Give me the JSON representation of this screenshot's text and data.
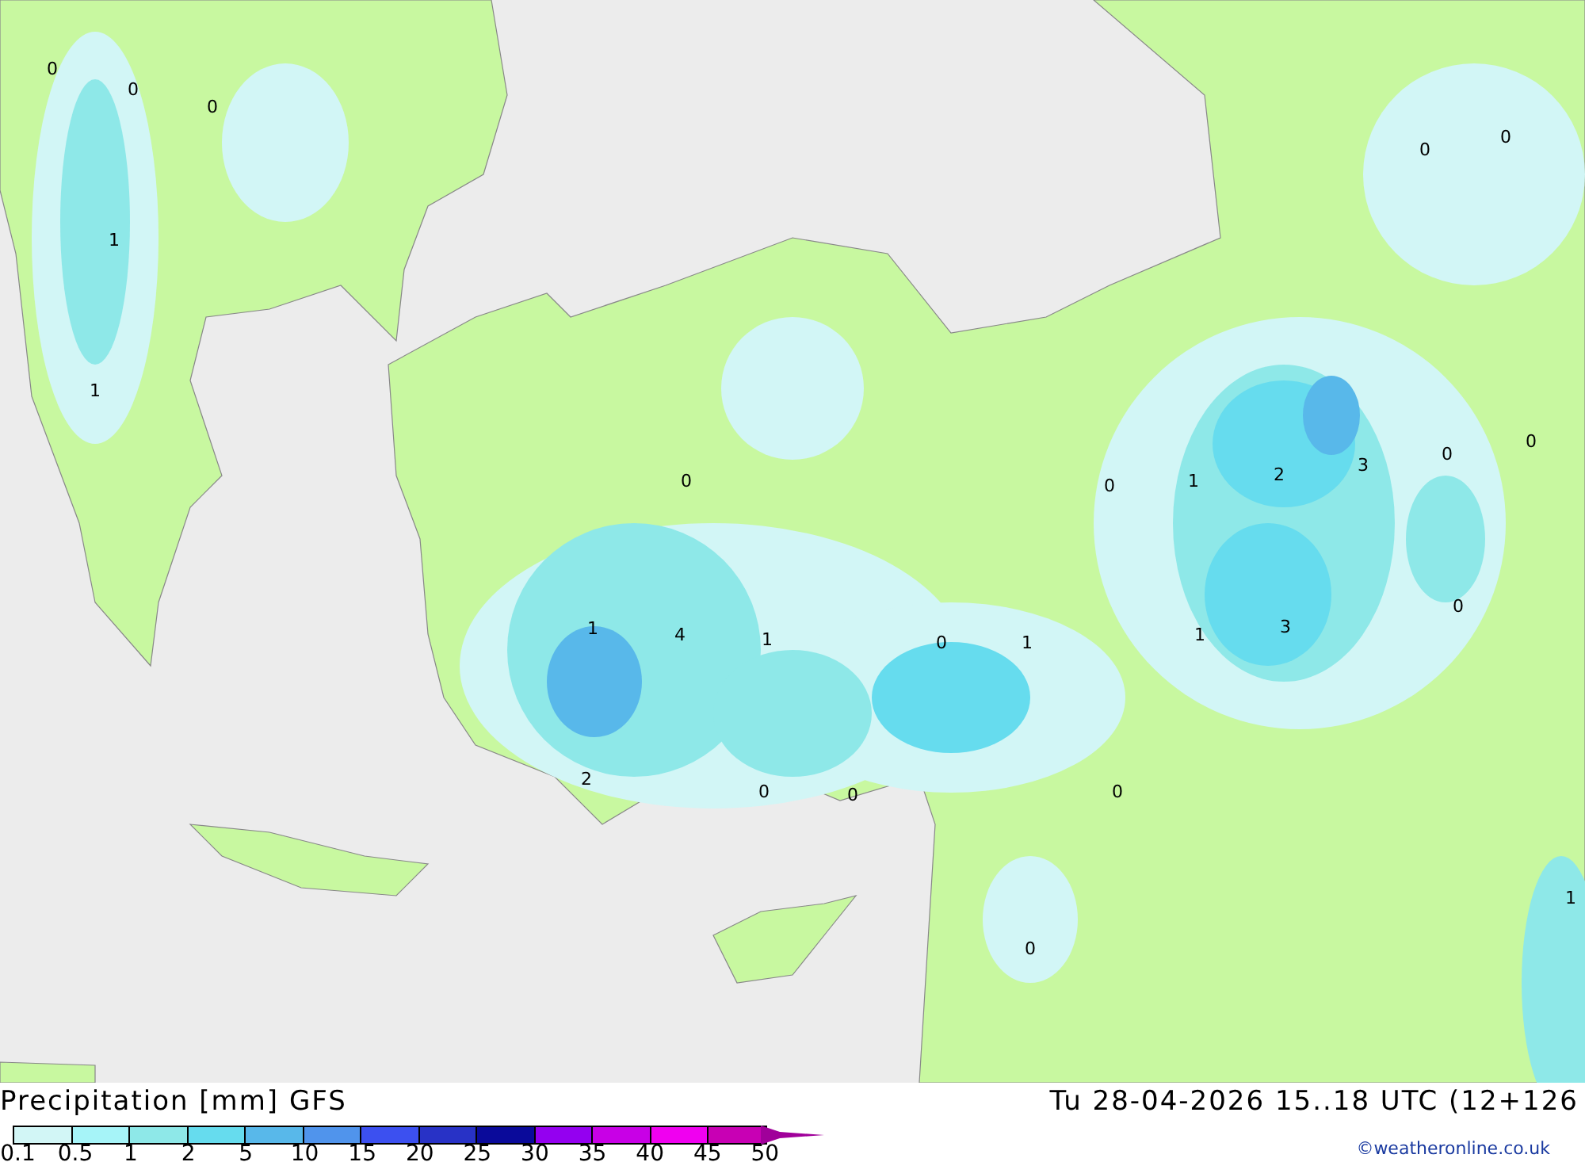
{
  "map": {
    "labels": [
      "0",
      "0",
      "0",
      "1",
      "1",
      "0",
      "0",
      "0",
      "0",
      "1",
      "2",
      "3",
      "0",
      "0",
      "1",
      "4",
      "1",
      "0",
      "1",
      "1",
      "3",
      "0",
      "2",
      "0",
      "0",
      "0",
      "0",
      "1"
    ]
  },
  "legend": {
    "title": "Precipitation [mm] GFS",
    "steps": [
      {
        "label": "0.1",
        "color": "#d2f6f6"
      },
      {
        "label": "0.5",
        "color": "#a6f4f8"
      },
      {
        "label": "1",
        "color": "#8ee8e8"
      },
      {
        "label": "2",
        "color": "#66dcee"
      },
      {
        "label": "5",
        "color": "#58b8ea"
      },
      {
        "label": "10",
        "color": "#5094ec"
      },
      {
        "label": "15",
        "color": "#3c50f0"
      },
      {
        "label": "20",
        "color": "#2832c6"
      },
      {
        "label": "25",
        "color": "#0a0a9a"
      },
      {
        "label": "30",
        "color": "#9400f0"
      },
      {
        "label": "35",
        "color": "#c800e6"
      },
      {
        "label": "40",
        "color": "#f000f0"
      },
      {
        "label": "45",
        "color": "#c800b4"
      }
    ],
    "last_label": "50"
  },
  "valid_time": "Tu 28-04-2026 15..18 UTC (12+126",
  "credit": "©weatheronline.co.uk"
}
